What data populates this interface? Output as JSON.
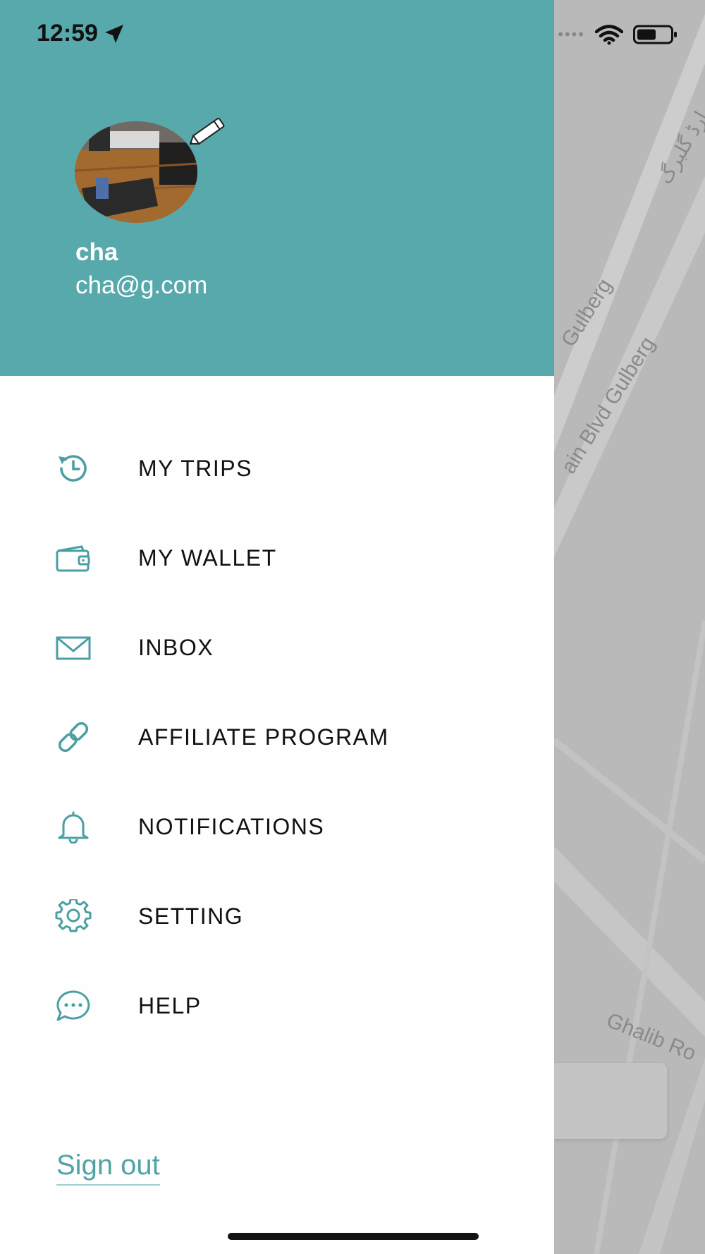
{
  "status_bar": {
    "time": "12:59",
    "icons": [
      "location-arrow-icon",
      "wifi-icon",
      "battery-icon"
    ]
  },
  "profile": {
    "name": "cha",
    "email": "cha@g.com",
    "avatar_icon": "avatar-photo",
    "edit_icon": "pencil-icon"
  },
  "menu": {
    "items": [
      {
        "label": "MY TRIPS",
        "icon": "history-icon"
      },
      {
        "label": "MY WALLET",
        "icon": "wallet-icon"
      },
      {
        "label": "INBOX",
        "icon": "envelope-icon"
      },
      {
        "label": "AFFILIATE PROGRAM",
        "icon": "link-icon"
      },
      {
        "label": "NOTIFICATIONS",
        "icon": "bell-icon"
      },
      {
        "label": "SETTING",
        "icon": "gear-icon"
      },
      {
        "label": "HELP",
        "icon": "chat-bubble-icon"
      }
    ]
  },
  "signout_label": "Sign out",
  "map": {
    "labels": [
      "Gulberg",
      "ain Blvd Gulberg",
      "Ghalib Ro",
      "بولیوارڈ گلبرگ"
    ]
  },
  "colors": {
    "accent": "#57a9ac",
    "icon_teal": "#4a9fa2",
    "drawer_bg": "#fefefe",
    "map_bg": "#b9b9b9"
  }
}
